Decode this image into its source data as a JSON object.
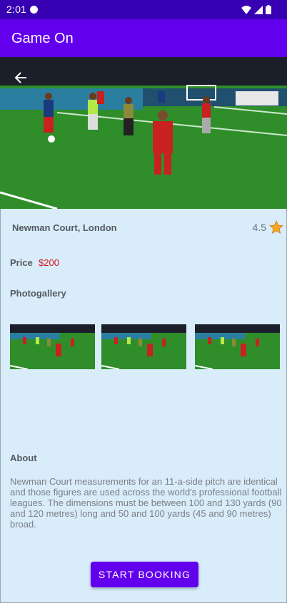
{
  "status_bar": {
    "time": "2:01",
    "icons": [
      "message-icon",
      "wifi-icon",
      "signal-icon",
      "battery-icon"
    ]
  },
  "app_bar": {
    "title": "Game On",
    "color": "#6200EE"
  },
  "hero": {
    "description_icon": "football-pitch-photo",
    "back_icon": "arrow-back-icon"
  },
  "venue": {
    "name": "Newman Court, London",
    "rating": "4.5",
    "rating_icon": "star-icon"
  },
  "price": {
    "label": "Price",
    "value": "$200",
    "color": "#d01616"
  },
  "gallery": {
    "label": "Photogallery",
    "count": 3
  },
  "about": {
    "label": "About",
    "text": "Newman Court measurements for an 11-a-side pitch are identical and those figures are used across the world's professional football leagues. The dimensions must be between 100 and 130 yards (90 and 120 metres) long and 50 and 100 yards (45 and 90 metres) broad."
  },
  "actions": {
    "start_booking": "START BOOKING"
  },
  "colors": {
    "primary": "#6200EE",
    "primary_dark": "#3700B3",
    "content_bg": "#D9ECFA"
  }
}
